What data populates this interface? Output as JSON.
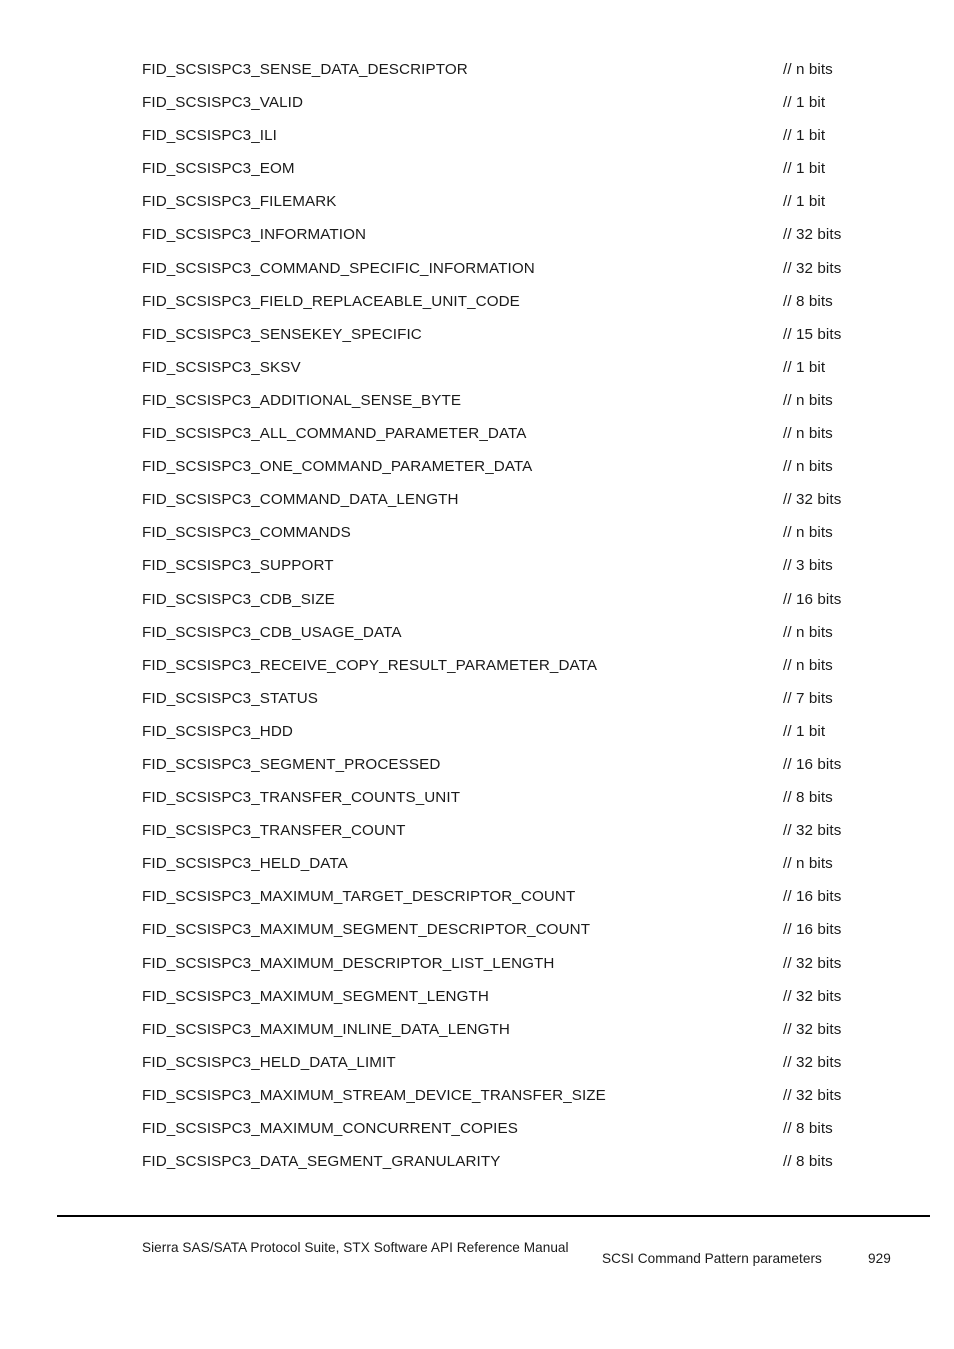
{
  "document": {
    "footer": {
      "doc_title": "Sierra SAS/SATA Protocol Suite, STX Software API Reference Manual",
      "section_title": "SCSI Command Pattern parameters",
      "page_number": "929"
    },
    "constants": [
      {
        "name": "FID_SCSISPC3_SENSE_DATA_DESCRIPTOR",
        "comment": "// n bits"
      },
      {
        "name": "FID_SCSISPC3_VALID",
        "comment": "// 1 bit"
      },
      {
        "name": "FID_SCSISPC3_ILI",
        "comment": "// 1 bit"
      },
      {
        "name": "FID_SCSISPC3_EOM",
        "comment": "// 1 bit"
      },
      {
        "name": "FID_SCSISPC3_FILEMARK",
        "comment": "// 1 bit"
      },
      {
        "name": "FID_SCSISPC3_INFORMATION",
        "comment": "// 32 bits"
      },
      {
        "name": "FID_SCSISPC3_COMMAND_SPECIFIC_INFORMATION",
        "comment": "// 32 bits"
      },
      {
        "name": "FID_SCSISPC3_FIELD_REPLACEABLE_UNIT_CODE",
        "comment": "// 8 bits"
      },
      {
        "name": "FID_SCSISPC3_SENSEKEY_SPECIFIC",
        "comment": "// 15 bits"
      },
      {
        "name": "FID_SCSISPC3_SKSV",
        "comment": "// 1 bit"
      },
      {
        "name": "FID_SCSISPC3_ADDITIONAL_SENSE_BYTE",
        "comment": "// n bits"
      },
      {
        "name": "FID_SCSISPC3_ALL_COMMAND_PARAMETER_DATA",
        "comment": "// n bits"
      },
      {
        "name": "FID_SCSISPC3_ONE_COMMAND_PARAMETER_DATA",
        "comment": "// n bits"
      },
      {
        "name": "FID_SCSISPC3_COMMAND_DATA_LENGTH",
        "comment": "// 32 bits"
      },
      {
        "name": "FID_SCSISPC3_COMMANDS",
        "comment": "// n bits"
      },
      {
        "name": "FID_SCSISPC3_SUPPORT",
        "comment": "// 3 bits"
      },
      {
        "name": "FID_SCSISPC3_CDB_SIZE",
        "comment": "// 16 bits"
      },
      {
        "name": "FID_SCSISPC3_CDB_USAGE_DATA",
        "comment": "// n bits"
      },
      {
        "name": "FID_SCSISPC3_RECEIVE_COPY_RESULT_PARAMETER_DATA",
        "comment": "// n bits"
      },
      {
        "name": "FID_SCSISPC3_STATUS",
        "comment": "// 7 bits"
      },
      {
        "name": "FID_SCSISPC3_HDD",
        "comment": "// 1 bit"
      },
      {
        "name": "FID_SCSISPC3_SEGMENT_PROCESSED",
        "comment": "// 16 bits"
      },
      {
        "name": "FID_SCSISPC3_TRANSFER_COUNTS_UNIT",
        "comment": "// 8 bits"
      },
      {
        "name": "FID_SCSISPC3_TRANSFER_COUNT",
        "comment": "// 32 bits"
      },
      {
        "name": "FID_SCSISPC3_HELD_DATA",
        "comment": "// n bits"
      },
      {
        "name": "FID_SCSISPC3_MAXIMUM_TARGET_DESCRIPTOR_COUNT",
        "comment": "// 16 bits"
      },
      {
        "name": "FID_SCSISPC3_MAXIMUM_SEGMENT_DESCRIPTOR_COUNT",
        "comment": "// 16 bits"
      },
      {
        "name": "FID_SCSISPC3_MAXIMUM_DESCRIPTOR_LIST_LENGTH",
        "comment": "// 32 bits"
      },
      {
        "name": "FID_SCSISPC3_MAXIMUM_SEGMENT_LENGTH",
        "comment": "// 32 bits"
      },
      {
        "name": "FID_SCSISPC3_MAXIMUM_INLINE_DATA_LENGTH",
        "comment": "// 32 bits"
      },
      {
        "name": "FID_SCSISPC3_HELD_DATA_LIMIT",
        "comment": "// 32 bits"
      },
      {
        "name": "FID_SCSISPC3_MAXIMUM_STREAM_DEVICE_TRANSFER_SIZE",
        "comment": "// 32 bits"
      },
      {
        "name": "FID_SCSISPC3_MAXIMUM_CONCURRENT_COPIES",
        "comment": "// 8 bits"
      },
      {
        "name": "FID_SCSISPC3_DATA_SEGMENT_GRANULARITY",
        "comment": "// 8 bits"
      }
    ]
  }
}
